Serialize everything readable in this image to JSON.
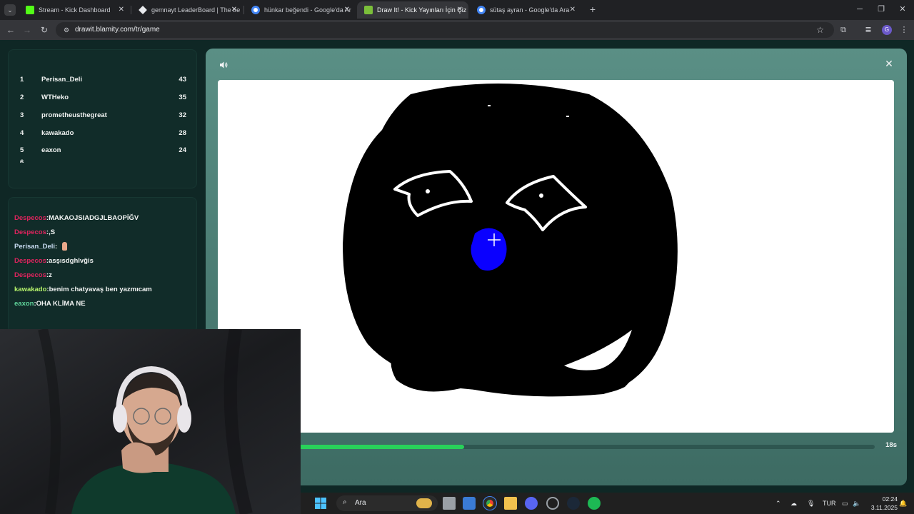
{
  "browser": {
    "tabs": [
      {
        "title": "Stream - Kick Dashboard",
        "favicon_color": "#53fc18",
        "active": false
      },
      {
        "title": "gemnayt LeaderBoard | The be",
        "favicon_color": "#e8eaed",
        "active": false
      },
      {
        "title": "hünkar beğendi - Google'da Ar",
        "favicon_color": "#e8eaed",
        "active": false
      },
      {
        "title": "Draw It! - Kick Yayınları İçin Çiz",
        "favicon_color": "#7bbf3a",
        "active": true
      },
      {
        "title": "sütaş ayran - Google'da Ara",
        "favicon_color": "#e8eaed",
        "active": false
      }
    ],
    "url": "drawit.blamity.com/tr/game",
    "profile_initial": "G"
  },
  "leaderboard": [
    {
      "rank": "1",
      "name": "Perisan_Deli",
      "score": "43"
    },
    {
      "rank": "2",
      "name": "WTHeko",
      "score": "35"
    },
    {
      "rank": "3",
      "name": "prometheusthegreat",
      "score": "32"
    },
    {
      "rank": "4",
      "name": "kawakado",
      "score": "28"
    },
    {
      "rank": "5",
      "name": "eaxon",
      "score": "24"
    }
  ],
  "chat": [
    {
      "user": "Despecos",
      "sep": ":",
      "message": "MAKAOJSIADGJLBAOPİĞV",
      "user_color": "#e0245e"
    },
    {
      "user": "Despecos",
      "sep": ":",
      "message": ",S",
      "user_color": "#e0245e"
    },
    {
      "user": "Perisan_Deli",
      "sep": ": ",
      "message": "",
      "user_color": "#c9dcf2",
      "emoji": "thumbs-up"
    },
    {
      "user": "Despecos",
      "sep": ":",
      "message": "asşısdghlvğis",
      "user_color": "#e0245e"
    },
    {
      "user": "Despecos",
      "sep": ":",
      "message": "z",
      "user_color": "#e0245e"
    },
    {
      "user": "kawakado",
      "sep": ":",
      "message": "benim chatyavaş ben yazmıcam",
      "user_color": "#b5f26b"
    },
    {
      "user": "eaxon",
      "sep": ":",
      "message": "OHA KLİMA NE",
      "user_color": "#5fd39a"
    }
  ],
  "game": {
    "timer": "18s",
    "progress_fraction": 0.375
  },
  "taskbar": {
    "search_placeholder": "Ara",
    "language": "TUR",
    "time": "02:24",
    "date": "3.11.2025"
  },
  "colors": {
    "accent_green": "#28d15a",
    "panel_teal": "#5a8f85",
    "brush_blue": "#0a00ff"
  }
}
